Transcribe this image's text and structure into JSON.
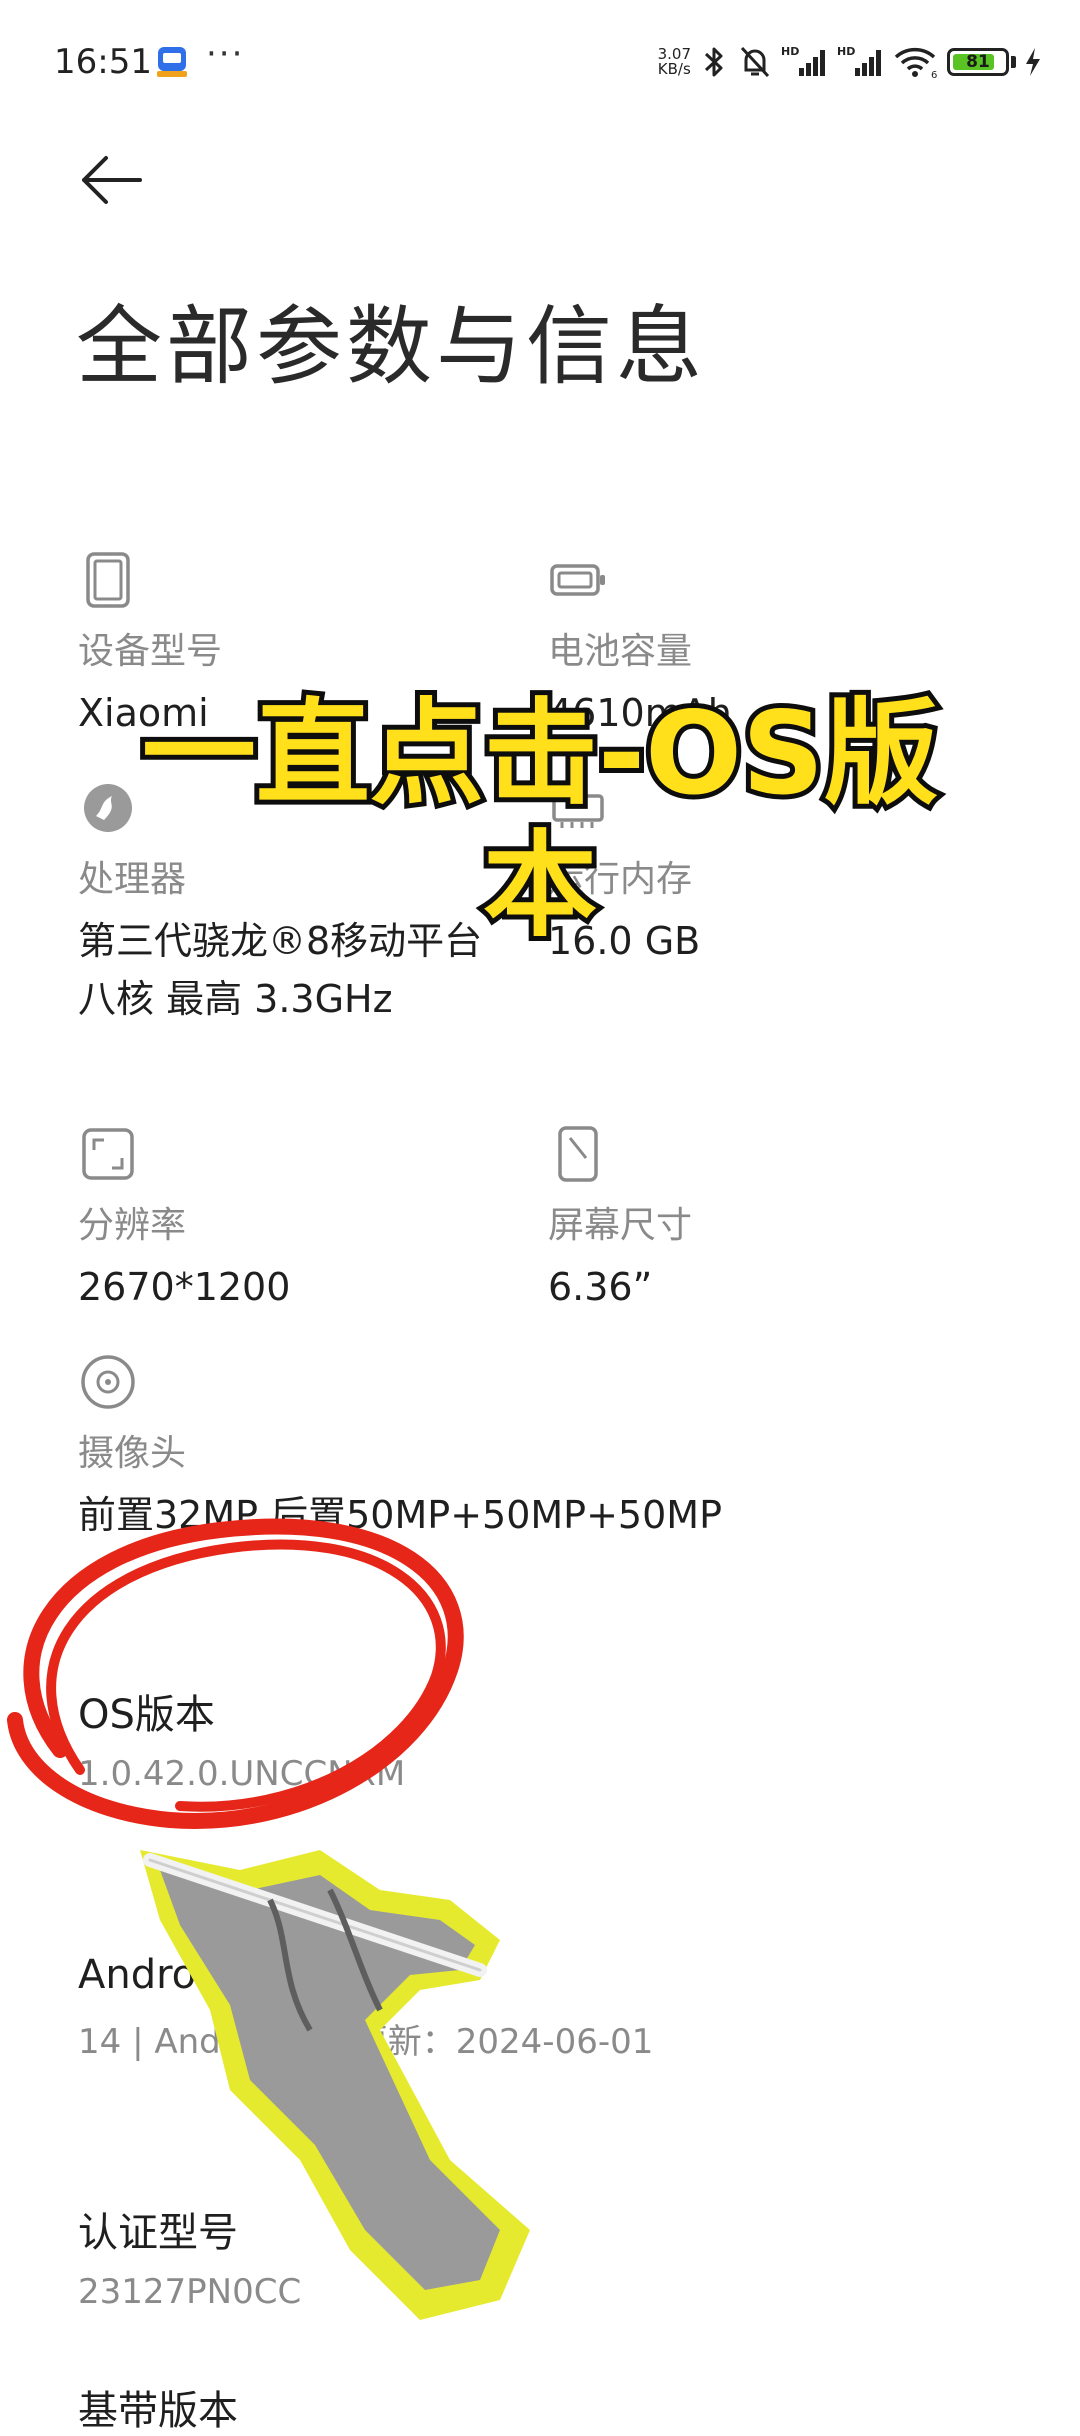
{
  "status_bar": {
    "time": "16:51",
    "dots": "···",
    "net_speed_value": "3.07",
    "net_speed_unit": "KB/s",
    "hd_label": "HD",
    "wifi_sub": "6",
    "battery_level": "81",
    "battery_fraction": 0.81,
    "battery_color": "#58c322"
  },
  "header": {
    "title": "全部参数与信息"
  },
  "specs": {
    "device_model": {
      "label": "设备型号",
      "value": "Xiaomi",
      "icon": "phone-icon"
    },
    "battery_capacity": {
      "label": "电池容量",
      "value": "4610mAh",
      "icon": "battery-outline-icon"
    },
    "processor": {
      "label": "处理器",
      "value": "第三代骁龙®8移动平台",
      "value2": "八核 最高 3.3GHz",
      "icon": "snapdragon-icon"
    },
    "ram": {
      "label": "运行内存",
      "value": "16.0 GB",
      "icon": "ram-icon"
    },
    "resolution": {
      "label": "分辨率",
      "value": "2670*1200",
      "icon": "resolution-icon"
    },
    "screen_size": {
      "label": "屏幕尺寸",
      "value": "6.36”",
      "icon": "screen-size-icon"
    },
    "camera": {
      "label": "摄像头",
      "value": "前置32MP 后置50MP+50MP+50MP",
      "icon": "camera-icon"
    }
  },
  "rows": {
    "os_version": {
      "title": "OS版本",
      "value": "1.0.42.0.UNCCNXM"
    },
    "android_version": {
      "title": "Android版本",
      "value": "14 | Android安全更新：2024-06-01"
    },
    "cert_model": {
      "title": "认证型号",
      "value": "23127PN0CC"
    },
    "baseband": {
      "title": "基带版本"
    }
  },
  "overlay": {
    "caption_line1": "一直点击-OS版",
    "caption_line2": "本",
    "caption_color": "#ffe01a",
    "circle_color": "#e62619",
    "hand_outline_color": "#e6ea2f"
  }
}
